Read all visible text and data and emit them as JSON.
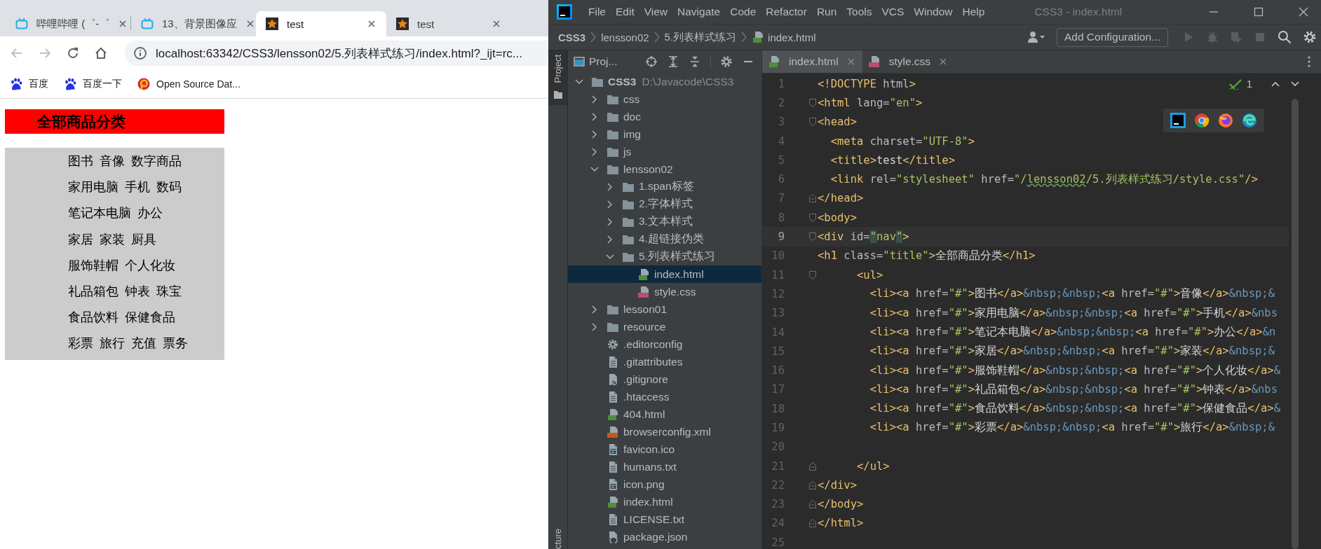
{
  "browser": {
    "tabs": [
      {
        "title": "哔哩哔哩 (゜-゜",
        "kind": "tv",
        "selected": false
      },
      {
        "title": "13、背景图像应",
        "kind": "tv",
        "selected": false
      },
      {
        "title": "test",
        "kind": "star",
        "selected": true
      },
      {
        "title": "test",
        "kind": "star",
        "selected": false
      }
    ],
    "url": "localhost:63342/CSS3/lensson02/5.列表样式练习/index.html?_ijt=rc...",
    "bookmarks": [
      {
        "label": "百度",
        "kind": "paw"
      },
      {
        "label": "百度一下",
        "kind": "paw"
      },
      {
        "label": "Open Source Dat...",
        "kind": "ring"
      }
    ],
    "page": {
      "heading": "全部商品分类",
      "categories": [
        [
          "图书",
          "音像",
          "数字商品"
        ],
        [
          "家用电脑",
          "手机",
          "数码"
        ],
        [
          "笔记本电脑",
          "办公"
        ],
        [
          "家居",
          "家装",
          "厨具"
        ],
        [
          "服饰鞋帽",
          "个人化妆"
        ],
        [
          "礼品箱包",
          "钟表",
          "珠宝"
        ],
        [
          "食品饮料",
          "保健食品"
        ],
        [
          "彩票",
          "旅行",
          "充值",
          "票务"
        ]
      ]
    }
  },
  "ide": {
    "menu": [
      "File",
      "Edit",
      "View",
      "Navigate",
      "Code",
      "Refactor",
      "Run",
      "Tools",
      "VCS",
      "Window",
      "Help"
    ],
    "window_title": "CSS3 - index.html",
    "breadcrumbs": [
      {
        "label": "CSS3",
        "kind": "project"
      },
      {
        "label": "lensson02",
        "kind": "folder"
      },
      {
        "label": "5.列表样式练习",
        "kind": "folder"
      },
      {
        "label": "index.html",
        "kind": "html"
      }
    ],
    "run_config": "Add Configuration...",
    "side_labels": [
      "Project",
      "cture"
    ],
    "project_panel": {
      "title": "Proj...",
      "tree": [
        {
          "label": "CSS3",
          "note": "D:\\Javacode\\CSS3",
          "kind": "folder",
          "expanded": true,
          "selected": false,
          "children": [
            {
              "label": "css",
              "kind": "folder",
              "expanded": false,
              "selected": false
            },
            {
              "label": "doc",
              "kind": "folder",
              "expanded": false,
              "selected": false
            },
            {
              "label": "img",
              "kind": "folder",
              "expanded": false,
              "selected": false
            },
            {
              "label": "js",
              "kind": "folder",
              "expanded": false,
              "selected": false
            },
            {
              "label": "lensson02",
              "kind": "folder",
              "expanded": true,
              "selected": false,
              "children": [
                {
                  "label": "1.span标签",
                  "kind": "folder",
                  "expanded": false,
                  "selected": false
                },
                {
                  "label": "2.字体样式",
                  "kind": "folder",
                  "expanded": false,
                  "selected": false
                },
                {
                  "label": "3.文本样式",
                  "kind": "folder",
                  "expanded": false,
                  "selected": false
                },
                {
                  "label": "4.超链接伪类",
                  "kind": "folder",
                  "expanded": false,
                  "selected": false
                },
                {
                  "label": "5.列表样式练习",
                  "kind": "folder",
                  "expanded": true,
                  "selected": false,
                  "children": [
                    {
                      "label": "index.html",
                      "kind": "html",
                      "selected": true
                    },
                    {
                      "label": "style.css",
                      "kind": "css",
                      "selected": false
                    }
                  ]
                }
              ]
            },
            {
              "label": "lesson01",
              "kind": "folder",
              "expanded": false,
              "selected": false
            },
            {
              "label": "resource",
              "kind": "folder",
              "expanded": false,
              "selected": false
            },
            {
              "label": ".editorconfig",
              "kind": "config",
              "selected": false
            },
            {
              "label": ".gitattributes",
              "kind": "text",
              "selected": false
            },
            {
              "label": ".gitignore",
              "kind": "ignore",
              "selected": false
            },
            {
              "label": ".htaccess",
              "kind": "text",
              "selected": false
            },
            {
              "label": "404.html",
              "kind": "html",
              "selected": false
            },
            {
              "label": "browserconfig.xml",
              "kind": "xml",
              "selected": false
            },
            {
              "label": "favicon.ico",
              "kind": "image",
              "selected": false
            },
            {
              "label": "humans.txt",
              "kind": "text",
              "selected": false
            },
            {
              "label": "icon.png",
              "kind": "image",
              "selected": false
            },
            {
              "label": "index.html",
              "kind": "html",
              "selected": false
            },
            {
              "label": "LICENSE.txt",
              "kind": "text",
              "selected": false
            },
            {
              "label": "package.json",
              "kind": "json",
              "selected": false
            }
          ]
        }
      ]
    },
    "editor_tabs": [
      {
        "label": "index.html",
        "kind": "html",
        "selected": true
      },
      {
        "label": "style.css",
        "kind": "css",
        "selected": false
      }
    ],
    "problems": "1",
    "code_lines": [
      {
        "number": "1",
        "current": false,
        "tokens": [
          {
            "kind": "tag",
            "text": "<!DOCTYPE"
          },
          {
            "kind": "attr",
            "text": " html"
          },
          {
            "kind": "tag",
            "text": ">"
          }
        ]
      },
      {
        "number": "2",
        "current": false,
        "kind": "fold-start",
        "tokens": [
          {
            "kind": "tag",
            "text": "<html "
          },
          {
            "kind": "attr",
            "text": "lang="
          },
          {
            "kind": "string",
            "text": "\"en\""
          },
          {
            "kind": "tag",
            "text": ">"
          }
        ]
      },
      {
        "number": "3",
        "current": false,
        "kind": "fold-start",
        "tokens": [
          {
            "kind": "tag",
            "text": "<head>"
          }
        ]
      },
      {
        "number": "4",
        "current": false,
        "tokens": [
          {
            "kind": "tag",
            "text": "  <meta "
          },
          {
            "kind": "attr",
            "text": "charset="
          },
          {
            "kind": "string",
            "text": "\"UTF-8\""
          },
          {
            "kind": "tag",
            "text": ">"
          }
        ]
      },
      {
        "number": "5",
        "current": false,
        "tokens": [
          {
            "kind": "tag",
            "text": "  <title>"
          },
          {
            "kind": "text",
            "text": "test"
          },
          {
            "kind": "tag",
            "text": "</title>"
          }
        ]
      },
      {
        "number": "6",
        "current": false,
        "tokens": [
          {
            "kind": "tag",
            "text": "  <link "
          },
          {
            "kind": "attr",
            "text": "rel="
          },
          {
            "kind": "string",
            "text": "\"stylesheet\""
          },
          {
            "kind": "attr",
            "text": " href="
          },
          {
            "kind": "string",
            "text": "\"/"
          },
          {
            "kind": "typo",
            "text": "lensson02"
          },
          {
            "kind": "string",
            "text": "/5.列表样式练习/style.css\""
          },
          {
            "kind": "tag",
            "text": "/>"
          }
        ]
      },
      {
        "number": "7",
        "current": false,
        "kind": "fold-end",
        "tokens": [
          {
            "kind": "tag",
            "text": "</head>"
          }
        ]
      },
      {
        "number": "8",
        "current": false,
        "kind": "fold-start",
        "tokens": [
          {
            "kind": "tag",
            "text": "<body>"
          }
        ]
      },
      {
        "number": "9",
        "current": true,
        "kind": "fold-start",
        "tokens": [
          {
            "kind": "tag",
            "text": "<div "
          },
          {
            "kind": "attr",
            "text": "id="
          },
          {
            "kind": "match",
            "text": "\""
          },
          {
            "kind": "string",
            "text": "nav"
          },
          {
            "kind": "match",
            "text": "\""
          },
          {
            "kind": "tag",
            "text": ">"
          }
        ]
      },
      {
        "number": "10",
        "current": false,
        "tokens": [
          {
            "kind": "tag",
            "text": "<h1 "
          },
          {
            "kind": "attr",
            "text": "class="
          },
          {
            "kind": "string",
            "text": "\"title\""
          },
          {
            "kind": "tag",
            "text": ">"
          },
          {
            "kind": "text",
            "text": "全部商品分类"
          },
          {
            "kind": "tag",
            "text": "</h1>"
          }
        ]
      },
      {
        "number": "11",
        "current": false,
        "kind": "fold-start",
        "tokens": [
          {
            "kind": "tag",
            "text": "      <ul>"
          }
        ]
      },
      {
        "number": "12",
        "current": false,
        "tokens": [
          {
            "kind": "tag",
            "text": "        <li><a "
          },
          {
            "kind": "attr",
            "text": "href="
          },
          {
            "kind": "string",
            "text": "\"#\""
          },
          {
            "kind": "tag",
            "text": ">"
          },
          {
            "kind": "text",
            "text": "图书"
          },
          {
            "kind": "tag",
            "text": "</a>"
          },
          {
            "kind": "entity",
            "text": "&nbsp;&nbsp;"
          },
          {
            "kind": "tag",
            "text": "<a "
          },
          {
            "kind": "attr",
            "text": "href="
          },
          {
            "kind": "string",
            "text": "\"#\""
          },
          {
            "kind": "tag",
            "text": ">"
          },
          {
            "kind": "text",
            "text": "音像"
          },
          {
            "kind": "tag",
            "text": "</a>"
          },
          {
            "kind": "entity",
            "text": "&nbsp;&"
          }
        ]
      },
      {
        "number": "13",
        "current": false,
        "tokens": [
          {
            "kind": "tag",
            "text": "        <li><a "
          },
          {
            "kind": "attr",
            "text": "href="
          },
          {
            "kind": "string",
            "text": "\"#\""
          },
          {
            "kind": "tag",
            "text": ">"
          },
          {
            "kind": "text",
            "text": "家用电脑"
          },
          {
            "kind": "tag",
            "text": "</a>"
          },
          {
            "kind": "entity",
            "text": "&nbsp;&nbsp;"
          },
          {
            "kind": "tag",
            "text": "<a "
          },
          {
            "kind": "attr",
            "text": "href="
          },
          {
            "kind": "string",
            "text": "\"#\""
          },
          {
            "kind": "tag",
            "text": ">"
          },
          {
            "kind": "text",
            "text": "手机"
          },
          {
            "kind": "tag",
            "text": "</a>"
          },
          {
            "kind": "entity",
            "text": "&nbs"
          }
        ]
      },
      {
        "number": "14",
        "current": false,
        "tokens": [
          {
            "kind": "tag",
            "text": "        <li><a "
          },
          {
            "kind": "attr",
            "text": "href="
          },
          {
            "kind": "string",
            "text": "\"#\""
          },
          {
            "kind": "tag",
            "text": ">"
          },
          {
            "kind": "text",
            "text": "笔记本电脑"
          },
          {
            "kind": "tag",
            "text": "</a>"
          },
          {
            "kind": "entity",
            "text": "&nbsp;&nbsp;"
          },
          {
            "kind": "tag",
            "text": "<a "
          },
          {
            "kind": "attr",
            "text": "href="
          },
          {
            "kind": "string",
            "text": "\"#\""
          },
          {
            "kind": "tag",
            "text": ">"
          },
          {
            "kind": "text",
            "text": "办公"
          },
          {
            "kind": "tag",
            "text": "</a>"
          },
          {
            "kind": "entity",
            "text": "&n"
          }
        ]
      },
      {
        "number": "15",
        "current": false,
        "tokens": [
          {
            "kind": "tag",
            "text": "        <li><a "
          },
          {
            "kind": "attr",
            "text": "href="
          },
          {
            "kind": "string",
            "text": "\"#\""
          },
          {
            "kind": "tag",
            "text": ">"
          },
          {
            "kind": "text",
            "text": "家居"
          },
          {
            "kind": "tag",
            "text": "</a>"
          },
          {
            "kind": "entity",
            "text": "&nbsp;&nbsp;"
          },
          {
            "kind": "tag",
            "text": "<a "
          },
          {
            "kind": "attr",
            "text": "href="
          },
          {
            "kind": "string",
            "text": "\"#\""
          },
          {
            "kind": "tag",
            "text": ">"
          },
          {
            "kind": "text",
            "text": "家装"
          },
          {
            "kind": "tag",
            "text": "</a>"
          },
          {
            "kind": "entity",
            "text": "&nbsp;&"
          }
        ]
      },
      {
        "number": "16",
        "current": false,
        "tokens": [
          {
            "kind": "tag",
            "text": "        <li><a "
          },
          {
            "kind": "attr",
            "text": "href="
          },
          {
            "kind": "string",
            "text": "\"#\""
          },
          {
            "kind": "tag",
            "text": ">"
          },
          {
            "kind": "text",
            "text": "服饰鞋帽"
          },
          {
            "kind": "tag",
            "text": "</a>"
          },
          {
            "kind": "entity",
            "text": "&nbsp;&nbsp;"
          },
          {
            "kind": "tag",
            "text": "<a "
          },
          {
            "kind": "attr",
            "text": "href="
          },
          {
            "kind": "string",
            "text": "\"#\""
          },
          {
            "kind": "tag",
            "text": ">"
          },
          {
            "kind": "text",
            "text": "个人化妆"
          },
          {
            "kind": "tag",
            "text": "</a>"
          },
          {
            "kind": "entity",
            "text": "&"
          }
        ]
      },
      {
        "number": "17",
        "current": false,
        "tokens": [
          {
            "kind": "tag",
            "text": "        <li><a "
          },
          {
            "kind": "attr",
            "text": "href="
          },
          {
            "kind": "string",
            "text": "\"#\""
          },
          {
            "kind": "tag",
            "text": ">"
          },
          {
            "kind": "text",
            "text": "礼品箱包"
          },
          {
            "kind": "tag",
            "text": "</a>"
          },
          {
            "kind": "entity",
            "text": "&nbsp;&nbsp;"
          },
          {
            "kind": "tag",
            "text": "<a "
          },
          {
            "kind": "attr",
            "text": "href="
          },
          {
            "kind": "string",
            "text": "\"#\""
          },
          {
            "kind": "tag",
            "text": ">"
          },
          {
            "kind": "text",
            "text": "钟表"
          },
          {
            "kind": "tag",
            "text": "</a>"
          },
          {
            "kind": "entity",
            "text": "&nbs"
          }
        ]
      },
      {
        "number": "18",
        "current": false,
        "tokens": [
          {
            "kind": "tag",
            "text": "        <li><a "
          },
          {
            "kind": "attr",
            "text": "href="
          },
          {
            "kind": "string",
            "text": "\"#\""
          },
          {
            "kind": "tag",
            "text": ">"
          },
          {
            "kind": "text",
            "text": "食品饮料"
          },
          {
            "kind": "tag",
            "text": "</a>"
          },
          {
            "kind": "entity",
            "text": "&nbsp;&nbsp;"
          },
          {
            "kind": "tag",
            "text": "<a "
          },
          {
            "kind": "attr",
            "text": "href="
          },
          {
            "kind": "string",
            "text": "\"#\""
          },
          {
            "kind": "tag",
            "text": ">"
          },
          {
            "kind": "text",
            "text": "保健食品"
          },
          {
            "kind": "tag",
            "text": "</a>"
          },
          {
            "kind": "entity",
            "text": "&"
          }
        ]
      },
      {
        "number": "19",
        "current": false,
        "tokens": [
          {
            "kind": "tag",
            "text": "        <li><a "
          },
          {
            "kind": "attr",
            "text": "href="
          },
          {
            "kind": "string",
            "text": "\"#\""
          },
          {
            "kind": "tag",
            "text": ">"
          },
          {
            "kind": "text",
            "text": "彩票"
          },
          {
            "kind": "tag",
            "text": "</a>"
          },
          {
            "kind": "entity",
            "text": "&nbsp;&nbsp;"
          },
          {
            "kind": "tag",
            "text": "<a "
          },
          {
            "kind": "attr",
            "text": "href="
          },
          {
            "kind": "string",
            "text": "\"#\""
          },
          {
            "kind": "tag",
            "text": ">"
          },
          {
            "kind": "text",
            "text": "旅行"
          },
          {
            "kind": "tag",
            "text": "</a>"
          },
          {
            "kind": "entity",
            "text": "&nbsp;&"
          }
        ]
      },
      {
        "number": "20",
        "current": false
      },
      {
        "number": "21",
        "current": false,
        "kind": "fold-end",
        "tokens": [
          {
            "kind": "tag",
            "text": "      </ul>"
          }
        ]
      },
      {
        "number": "22",
        "current": false,
        "kind": "fold-end",
        "tokens": [
          {
            "kind": "tag",
            "text": "</div>"
          }
        ]
      },
      {
        "number": "23",
        "current": false,
        "kind": "fold-end",
        "tokens": [
          {
            "kind": "tag",
            "text": "</body>"
          }
        ]
      },
      {
        "number": "24",
        "current": false,
        "kind": "fold-end",
        "tokens": [
          {
            "kind": "tag",
            "text": "</html>"
          }
        ]
      },
      {
        "number": "25",
        "current": false
      }
    ]
  }
}
